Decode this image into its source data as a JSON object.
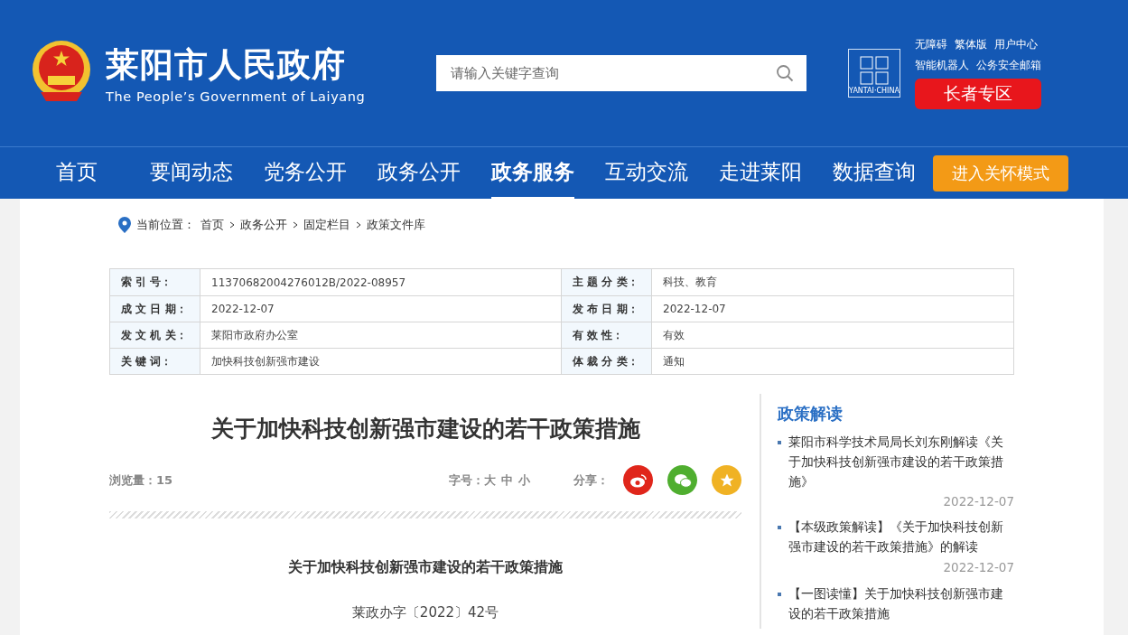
{
  "header": {
    "site_title": "莱阳市人民政府",
    "site_subtitle": "The People’s Government of Laiyang",
    "search": {
      "placeholder": "请输入关键字查询"
    },
    "badge_caption": "YANTAI·CHINA",
    "top_links": [
      [
        "无障碍",
        "繁体版",
        "用户中心"
      ],
      [
        "智能机器人",
        "公务安全邮箱"
      ]
    ],
    "elder_button": "长者专区"
  },
  "nav": {
    "items": [
      {
        "label": "首页",
        "selected": false
      },
      {
        "label": "要闻动态",
        "selected": false
      },
      {
        "label": "党务公开",
        "selected": false
      },
      {
        "label": "政务公开",
        "selected": false
      },
      {
        "label": "政务服务",
        "selected": true
      },
      {
        "label": "互动交流",
        "selected": false
      },
      {
        "label": "走进莱阳",
        "selected": false
      },
      {
        "label": "数据查询",
        "selected": false
      }
    ],
    "care_button": "进入关怀模式"
  },
  "breadcrumb": {
    "label": "当前位置：",
    "path": [
      "首页",
      "政务公开",
      "固定栏目",
      "政策文件库"
    ]
  },
  "info_table": {
    "rows": [
      [
        {
          "label": "索 引 号：",
          "value": "11370682004276012B/2022-08957"
        },
        {
          "label": "主 题 分 类：",
          "value": "科技、教育"
        }
      ],
      [
        {
          "label": "成 文 日 期：",
          "value": "2022-12-07"
        },
        {
          "label": "发 布 日 期：",
          "value": "2022-12-07"
        }
      ],
      [
        {
          "label": "发 文 机 关：",
          "value": "莱阳市政府办公室"
        },
        {
          "label": "有 效 性：",
          "value": "有效"
        }
      ],
      [
        {
          "label": "关 键 词：",
          "value": "加快科技创新强市建设"
        },
        {
          "label": "体 裁 分 类：",
          "value": "通知"
        }
      ]
    ]
  },
  "article": {
    "title": "关于加快科技创新强市建设的若干政策措施",
    "views_label": "浏览量：",
    "views": "15",
    "font_label": "字号：",
    "font_sizes": [
      "大",
      "中",
      "小"
    ],
    "share_label": "分享：",
    "share": [
      {
        "kind": "weibo",
        "color": "#e0261b"
      },
      {
        "kind": "wechat",
        "color": "#4fae2f"
      },
      {
        "kind": "favorite",
        "color": "#f0b224"
      }
    ],
    "doc_title": "关于加快科技创新强市建设的若干政策措施",
    "doc_number": "莱政办字〔2022〕42号"
  },
  "sidebar": {
    "title": "政策解读",
    "items": [
      {
        "text": "莱阳市科学技术局局长刘东刚解读《关于加快科技创新强市建设的若干政策措施》",
        "date": "2022-12-07"
      },
      {
        "text": "【本级政策解读】《关于加快科技创新强市建设的若干政策措施》的解读",
        "date": "2022-12-07"
      },
      {
        "text": "【一图读懂】关于加快科技创新强市建设的若干政策措施"
      }
    ]
  }
}
